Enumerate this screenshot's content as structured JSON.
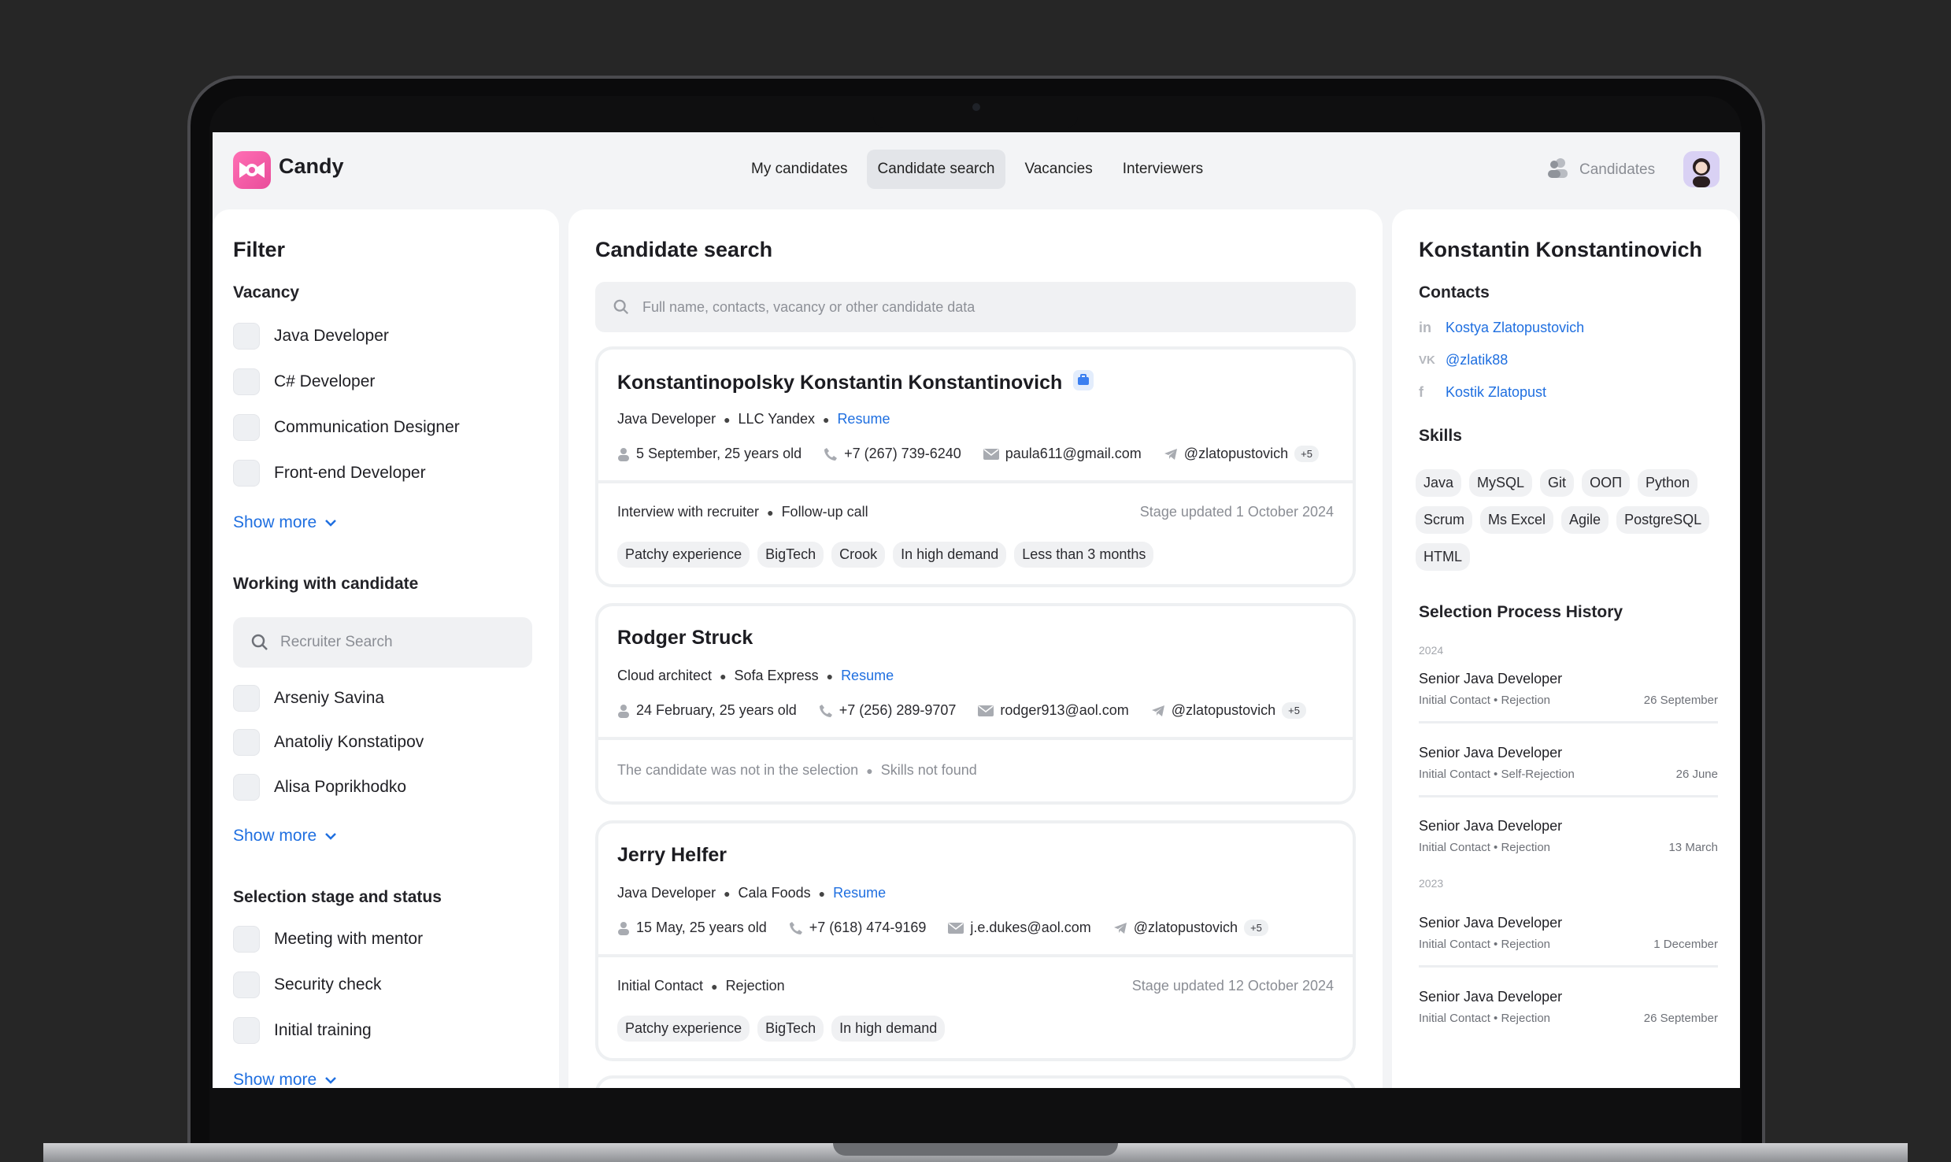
{
  "app": {
    "name": "Candy"
  },
  "nav": {
    "items": [
      {
        "label": "My candidates",
        "active": false
      },
      {
        "label": "Candidate search",
        "active": true
      },
      {
        "label": "Vacancies",
        "active": false
      },
      {
        "label": "Interviewers",
        "active": false
      }
    ],
    "candidates_link": "Candidates"
  },
  "filter": {
    "title": "Filter",
    "vacancy": {
      "title": "Vacancy",
      "options": [
        "Java Developer",
        "C# Developer",
        "Communication Designer",
        "Front-end Developer"
      ],
      "show_more": "Show more"
    },
    "working": {
      "title": "Working with candidate",
      "search_placeholder": "Recruiter Search",
      "options": [
        "Arseniy Savina",
        "Anatoliy Konstatipov",
        "Alisa Poprikhodko"
      ],
      "show_more": "Show more"
    },
    "stage": {
      "title": "Selection stage and status",
      "options": [
        "Meeting with mentor",
        "Security check",
        "Initial training"
      ],
      "show_more": "Show more"
    }
  },
  "search": {
    "title": "Candidate search",
    "placeholder": "Full name, contacts, vacancy or other candidate data",
    "results": [
      {
        "name": "Konstantinopolsky Konstantin Konstantinovich",
        "role": "Java Developer",
        "company": "LLC Yandex",
        "resume": "Resume",
        "birth": "5 September, 25 years old",
        "phone": "+7 (267) 739-6240",
        "email": "paula611@gmail.com",
        "telegram": "@zlatopustovich",
        "more": "+5",
        "stage": "Interview with recruiter",
        "status": "Follow-up call",
        "updated": "Stage updated 1 October 2024",
        "tags": [
          "Patchy experience",
          "BigTech",
          "Crook",
          "In high demand",
          "Less than 3 months"
        ]
      },
      {
        "name": "Rodger Struck",
        "role": "Cloud architect",
        "company": "Sofa Express",
        "resume": "Resume",
        "birth": "24 February, 25 years old",
        "phone": "+7 (256) 289-9707",
        "email": "rodger913@aol.com",
        "telegram": "@zlatopustovich",
        "more": "+5",
        "stage": "The candidate was not in the selection",
        "status": "Skills not found"
      },
      {
        "name": "Jerry Helfer",
        "role": "Java Developer",
        "company": "Cala Foods",
        "resume": "Resume",
        "birth": "15 May, 25 years old",
        "phone": "+7 (618) 474-9169",
        "email": "j.e.dukes@aol.com",
        "telegram": "@zlatopustovich",
        "more": "+5",
        "stage": "Initial Contact",
        "status": "Rejection",
        "updated": "Stage updated 12 October 2024",
        "tags": [
          "Patchy experience",
          "BigTech",
          "In high demand"
        ]
      }
    ]
  },
  "profile": {
    "name": "Konstantin Konstantinovich",
    "contacts_title": "Contacts",
    "contacts": [
      {
        "icon": "linkedin-icon",
        "label": "Kostya Zlatopustovich"
      },
      {
        "icon": "vk-icon",
        "label": "@zlatik88"
      },
      {
        "icon": "facebook-icon",
        "label": "Kostik Zlatopust"
      }
    ],
    "skills_title": "Skills",
    "skills": [
      "Java",
      "MySQL",
      "Git",
      "ООП",
      "Python",
      "Scrum",
      "Ms Excel",
      "Agile",
      "PostgreSQL",
      "HTML"
    ],
    "history_title": "Selection Process History",
    "years": [
      "2024",
      "2023"
    ],
    "history": [
      {
        "title": "Senior Java Developer",
        "stages": "Initial Contact • Rejection",
        "date": "26 September"
      },
      {
        "title": "Senior Java Developer",
        "stages": "Initial Contact • Self-Rejection",
        "date": "26 June"
      },
      {
        "title": "Senior Java Developer",
        "stages": "Initial Contact • Rejection",
        "date": "13 March"
      },
      {
        "title": "Senior Java Developer",
        "stages": "Initial Contact • Rejection",
        "date": "1 December"
      },
      {
        "title": "Senior Java Developer",
        "stages": "Initial Contact • Rejection",
        "date": "26 September"
      }
    ]
  },
  "colors": {
    "accent": "#1f6fe0",
    "brand": "#ef5aa7",
    "surface": "#ffffff",
    "background": "#f3f4f6"
  }
}
